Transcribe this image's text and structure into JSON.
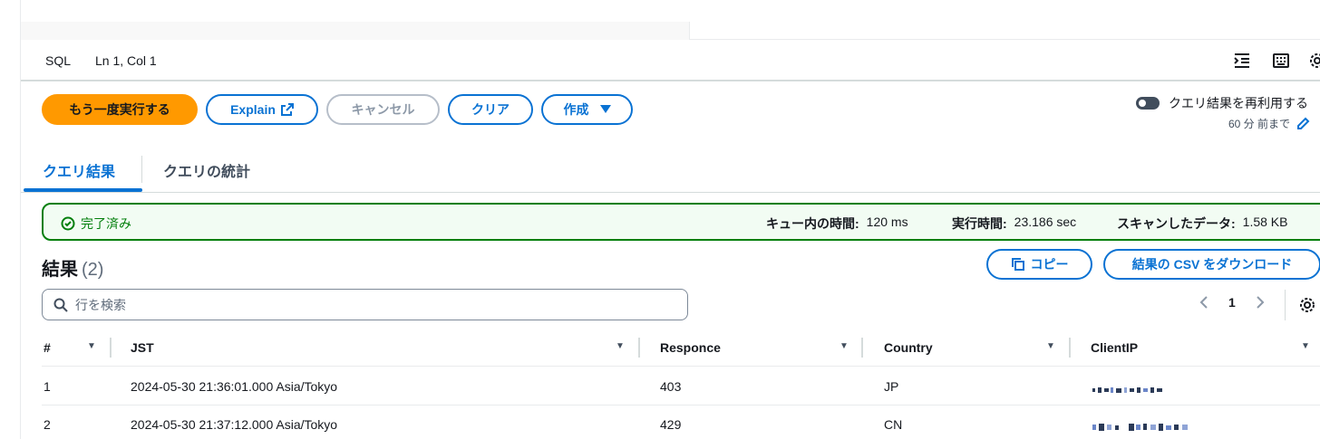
{
  "statusbar": {
    "language": "SQL",
    "cursor": "Ln 1, Col 1"
  },
  "toolbar": {
    "rerun": "もう一度実行する",
    "explain": "Explain",
    "cancel": "キャンセル",
    "clear": "クリア",
    "create": "作成"
  },
  "reuse": {
    "label": "クエリ結果を再利用する",
    "sub": "60 分 前まで"
  },
  "tabs": [
    {
      "label": "クエリ結果"
    },
    {
      "label": "クエリの統計"
    }
  ],
  "banner": {
    "status": "完了済み",
    "queue_label": "キュー内の時間:",
    "queue_value": "120 ms",
    "exec_label": "実行時間:",
    "exec_value": "23.186 sec",
    "scan_label": "スキャンしたデータ:",
    "scan_value": "1.58 KB"
  },
  "results": {
    "title": "結果",
    "count": "(2)",
    "copy": "コピー",
    "download": "結果の CSV をダウンロード",
    "search_placeholder": "行を検索",
    "page": "1"
  },
  "table": {
    "columns": [
      "#",
      "JST",
      "Responce",
      "Country",
      "ClientIP"
    ],
    "rows": [
      [
        "1",
        "2024-05-30 21:36:01.000 Asia/Tokyo",
        "403",
        "JP",
        ""
      ],
      [
        "2",
        "2024-05-30 21:37:12.000 Asia/Tokyo",
        "429",
        "CN",
        ""
      ]
    ]
  },
  "colors": {
    "accent": "#0972d3",
    "primary": "#ff9900",
    "success": "#037f0c",
    "success_bg": "#f2fcf3"
  }
}
